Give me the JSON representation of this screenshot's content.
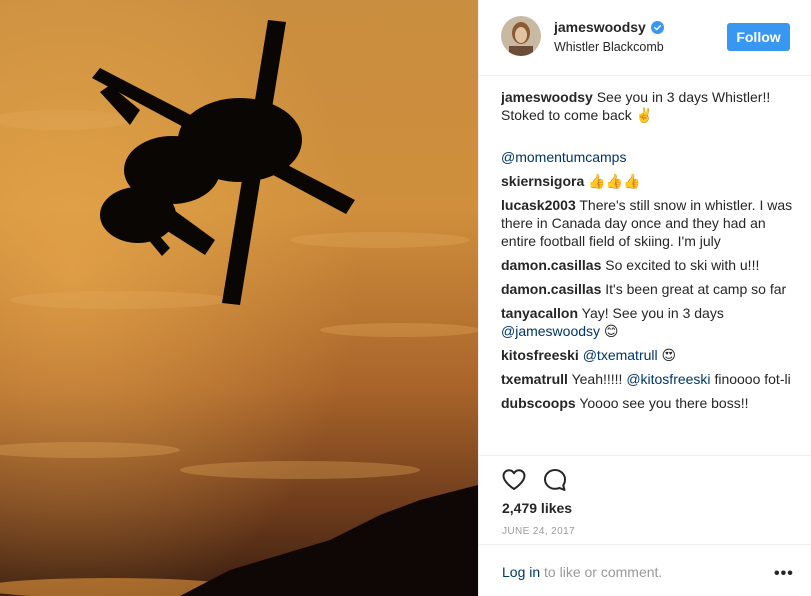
{
  "post": {
    "username": "jameswoodsy",
    "location": "Whistler Blackcomb",
    "follow_label": "Follow",
    "likes": "2,479 likes",
    "date": "JUNE 24, 2017"
  },
  "comments": [
    {
      "user": "jameswoodsy",
      "text": "See you in 3 days Whistler!! Stoked to come back ✌️"
    },
    {
      "user": "",
      "mention": "@momentumcamps",
      "text": ""
    },
    {
      "user": "skiernsigora",
      "text": "👍👍👍"
    },
    {
      "user": "lucask2003",
      "text": "There's still snow in whistler. I was there in Canada day once and they had an entire football field of skiing. I'm july"
    },
    {
      "user": "damon.casillas",
      "text": "So excited to ski with u!!!"
    },
    {
      "user": "damon.casillas",
      "text": "It's been great at camp so far"
    },
    {
      "user": "tanyacallon",
      "text": "Yay! See you in 3 days",
      "mention": "@jameswoodsy",
      "text2": "😊"
    },
    {
      "user": "kitosfreeski",
      "mention": "@txematrull",
      "text": "😍"
    },
    {
      "user": "txematrull",
      "text": "Yeah!!!!!",
      "mention": "@kitosfreeski",
      "text2": "finoooo fot-li"
    },
    {
      "user": "dubscoops",
      "text": "Yoooo see you there boss!!"
    }
  ],
  "footer": {
    "login_link": "Log in",
    "login_rest": " to like or comment.",
    "more": "•••"
  },
  "icons": {
    "verified": "verified-badge-icon",
    "like": "heart-icon",
    "comment": "comment-bubble-icon",
    "more": "more-options-icon"
  },
  "colors": {
    "accent": "#3897f0",
    "link": "#003569",
    "muted": "#999999",
    "text": "#262626"
  }
}
